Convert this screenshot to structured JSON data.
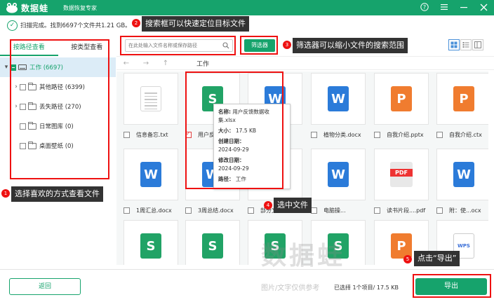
{
  "app": {
    "name": "数据蛙",
    "subtitle": "数据恢复专家"
  },
  "scan_status": "扫描完成。找到6697个文件共1.21 GB。",
  "left_panel": {
    "tabs": [
      {
        "label": "按路径查看",
        "active": true
      },
      {
        "label": "按类型查看",
        "active": false
      }
    ],
    "tree": [
      {
        "label": "工作 (6697)",
        "level": 0,
        "expanded": true
      },
      {
        "label": "其他路径 (6399)",
        "level": 1,
        "expandable": true
      },
      {
        "label": "丢失路径 (270)",
        "level": 1,
        "expandable": true
      },
      {
        "label": "日常图库 (0)",
        "level": 1,
        "expandable": false
      },
      {
        "label": "桌面壁纸 (0)",
        "level": 1,
        "expandable": false
      }
    ]
  },
  "toolbar": {
    "search_placeholder": "在此处输入文件名称或保存路径",
    "filter_label": "筛选器"
  },
  "nav": {
    "path": "工作"
  },
  "files": [
    {
      "name": "信息备忘.txt",
      "type": "txt",
      "checked": false
    },
    {
      "name": "用户反",
      "type": "xlsx",
      "checked": true
    },
    {
      "name": "cx",
      "type": "docx",
      "checked": false
    },
    {
      "name": "植物分类.docx",
      "type": "docx",
      "checked": false
    },
    {
      "name": "自我介绍.pptx",
      "type": "pptx",
      "checked": false
    },
    {
      "name": "自我介绍.ctx",
      "type": "pptx",
      "checked": false
    },
    {
      "name": "1周汇总.docx",
      "type": "docx",
      "checked": false
    },
    {
      "name": "3周总结.docx",
      "type": "docx",
      "checked": false
    },
    {
      "name": "部分文",
      "type": "docx",
      "checked": false
    },
    {
      "name": "电脑操...",
      "type": "docx",
      "checked": false
    },
    {
      "name": "读书片段....pdf",
      "type": "pdf",
      "checked": false
    },
    {
      "name": "附：使...ocx",
      "type": "docx",
      "checked": false
    },
    {
      "name": "",
      "type": "xlsx",
      "checked": false
    },
    {
      "name": "",
      "type": "xlsx",
      "checked": false
    },
    {
      "name": "",
      "type": "xlsx",
      "checked": false
    },
    {
      "name": "",
      "type": "xlsx",
      "checked": false
    },
    {
      "name": "",
      "type": "pptx",
      "checked": false
    },
    {
      "name": "",
      "type": "wps",
      "checked": false
    }
  ],
  "icon_glyphs": {
    "xlsx": "S",
    "docx": "W",
    "pptx": "P",
    "pdf": "PDF",
    "wps": "WPS"
  },
  "tooltip": {
    "name_key": "名称:",
    "name_val": "用户反馈数据收集.xlsx",
    "size_key": "大小：",
    "size_val": "17.5 KB",
    "created_key": "创建日期：",
    "created_val": "2024-09-29",
    "modified_key": "修改日期：",
    "modified_val": "2024-09-29",
    "path_key": "路径：",
    "path_val": "工作"
  },
  "bottom": {
    "back_label": "返回",
    "selection_info": "已选择 1个项目/ 17.5 KB",
    "export_label": "导出"
  },
  "annotations": [
    {
      "num": "1",
      "text": "选择喜欢的方式查看文件"
    },
    {
      "num": "2",
      "text": "搜索框可以快速定位目标文件"
    },
    {
      "num": "3",
      "text": "筛选器可以缩小文件的搜索范围"
    },
    {
      "num": "4",
      "text": "选中文件"
    },
    {
      "num": "5",
      "text": "点击“导出”"
    }
  ],
  "watermark": {
    "main": "数据蛙",
    "sub": "图片/文字仅供参考"
  },
  "colors": {
    "brand": "#16a36c",
    "annotation": "#e11111",
    "callout_bg": "#333333"
  }
}
